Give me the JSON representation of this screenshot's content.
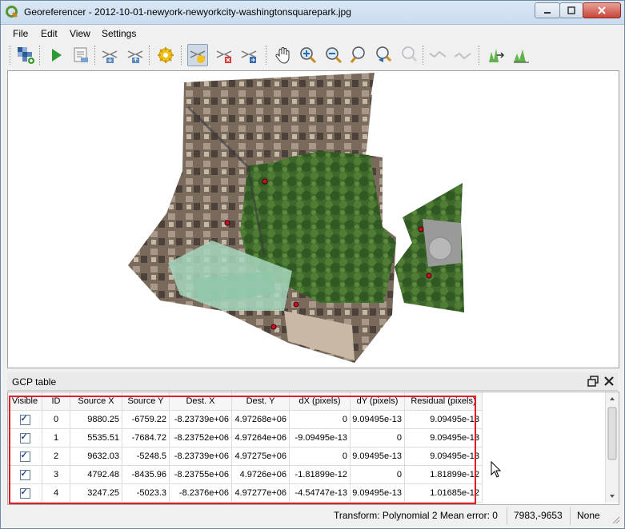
{
  "window": {
    "title": "Georeferencer - 2012-10-01-newyork-newyorkcity-washingtonsquarepark.jpg",
    "controls": [
      "minimize",
      "maximize",
      "close"
    ]
  },
  "menu": [
    "File",
    "Edit",
    "View",
    "Settings"
  ],
  "toolbar": [
    {
      "name": "open-raster-icon"
    },
    {
      "name": "start-georeferencing-icon"
    },
    {
      "name": "generate-gdal-script-icon"
    },
    {
      "name": "load-gcp-points-icon"
    },
    {
      "name": "save-gcp-points-icon"
    },
    {
      "name": "transformation-settings-icon"
    },
    {
      "name": "add-point-icon"
    },
    {
      "name": "delete-point-icon"
    },
    {
      "name": "move-gcp-point-icon"
    },
    {
      "name": "pan-icon"
    },
    {
      "name": "zoom-in-icon"
    },
    {
      "name": "zoom-out-icon"
    },
    {
      "name": "zoom-to-layer-icon"
    },
    {
      "name": "zoom-last-icon"
    },
    {
      "name": "zoom-next-icon"
    },
    {
      "name": "link-georeferencer-to-qgis-icon"
    },
    {
      "name": "link-qgis-to-georeferencer-icon"
    },
    {
      "name": "full-histogram-stretch-icon"
    },
    {
      "name": "local-histogram-stretch-icon"
    }
  ],
  "gcp_panel": {
    "title": "GCP table",
    "columns": [
      "Visible",
      "ID",
      "Source X",
      "Source Y",
      "Dest. X",
      "Dest. Y",
      "dX (pixels)",
      "dY (pixels)",
      "Residual (pixels)"
    ],
    "rows": [
      {
        "visible": true,
        "id": "0",
        "source_x": "9880.25",
        "source_y": "-6759.22",
        "dest_x": "-8.23739e+06",
        "dest_y": "4.97268e+06",
        "dx": "0",
        "dy": "9.09495e-13",
        "residual": "9.09495e-13"
      },
      {
        "visible": true,
        "id": "1",
        "source_x": "5535.51",
        "source_y": "-7684.72",
        "dest_x": "-8.23752e+06",
        "dest_y": "4.97264e+06",
        "dx": "-9.09495e-13",
        "dy": "0",
        "residual": "9.09495e-13"
      },
      {
        "visible": true,
        "id": "2",
        "source_x": "9632.03",
        "source_y": "-5248.5",
        "dest_x": "-8.23739e+06",
        "dest_y": "4.97275e+06",
        "dx": "0",
        "dy": "9.09495e-13",
        "residual": "9.09495e-13"
      },
      {
        "visible": true,
        "id": "3",
        "source_x": "4792.48",
        "source_y": "-8435.96",
        "dest_x": "-8.23755e+06",
        "dest_y": "4.9726e+06",
        "dx": "-1.81899e-12",
        "dy": "0",
        "residual": "1.81899e-12"
      },
      {
        "visible": true,
        "id": "4",
        "source_x": "3247.25",
        "source_y": "-5023.3",
        "dest_x": "-8.2376e+06",
        "dest_y": "4.97277e+06",
        "dx": "-4.54747e-13",
        "dy": "9.09495e-13",
        "residual": "1.01685e-12"
      }
    ]
  },
  "status": {
    "transform": "Transform: Polynomial 2 Mean error: 0",
    "coordinates": "7983,-9653",
    "crs": "None"
  },
  "colors": {
    "highlight": "#e01e2a",
    "gcp_point": "#c8102e"
  }
}
